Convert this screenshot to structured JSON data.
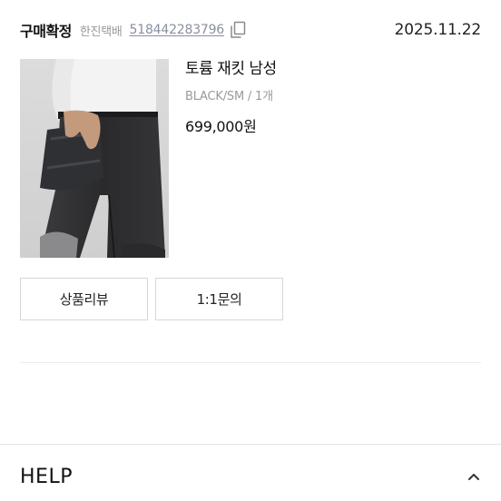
{
  "order": {
    "status": "구매확정",
    "carrier": "한진택배",
    "tracking_number": "518442283796",
    "date": "2025.11.22"
  },
  "product": {
    "name": "토륨 재킷 남성",
    "option": "BLACK/SM / 1개",
    "price": "699,000원",
    "image_icon": "product-photo"
  },
  "actions": {
    "review_label": "상품리뷰",
    "inquiry_label": "1:1문의"
  },
  "help": {
    "title": "HELP",
    "toggle_icon": "chevron-up-icon"
  },
  "icons": {
    "copy": "copy-icon"
  },
  "colors": {
    "muted_text": "#9a9a9a",
    "link_text": "#8a8fa0",
    "border": "#d6d6d6"
  }
}
